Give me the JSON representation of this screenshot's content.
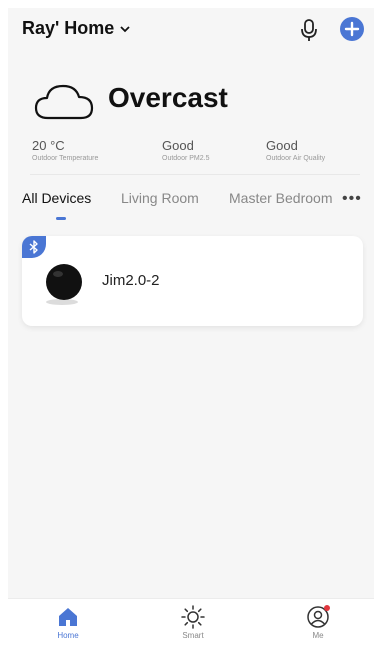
{
  "header": {
    "home_name": "Ray' Home"
  },
  "weather": {
    "condition": "Overcast",
    "metrics": [
      {
        "value": "20 °C",
        "label": "Outdoor Temperature"
      },
      {
        "value": "Good",
        "label": "Outdoor PM2.5"
      },
      {
        "value": "Good",
        "label": "Outdoor Air Quality"
      }
    ]
  },
  "tabs": [
    {
      "label": "All Devices",
      "active": true
    },
    {
      "label": "Living Room",
      "active": false
    },
    {
      "label": "Master Bedroom",
      "active": false
    }
  ],
  "more_label": "•••",
  "devices": [
    {
      "name": "Jim2.0-2",
      "connection": "bluetooth-icon"
    }
  ],
  "bottom_nav": [
    {
      "label": "Home",
      "icon": "home-icon",
      "active": true
    },
    {
      "label": "Smart",
      "icon": "sun-icon",
      "active": false
    },
    {
      "label": "Me",
      "icon": "user-icon",
      "active": false
    }
  ],
  "colors": {
    "accent": "#4a76d4",
    "notification": "#e0363d"
  }
}
